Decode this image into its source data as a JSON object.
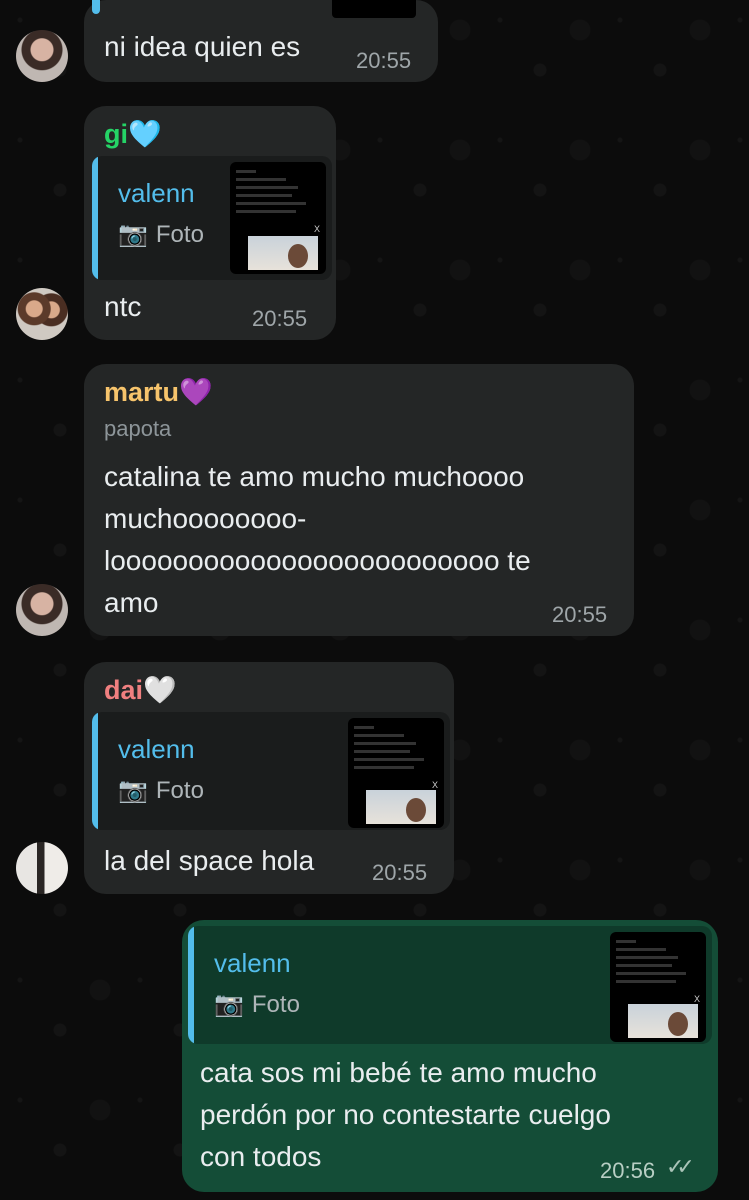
{
  "messages": [
    {
      "text": "ni idea quien es",
      "time": "20:55"
    },
    {
      "sender": "gi🩵",
      "quote": {
        "name": "valenn",
        "type": "Foto"
      },
      "text": "ntc",
      "time": "20:55"
    },
    {
      "sender": "martu💜",
      "subtitle": "papota",
      "text": "catalina te amo mucho muchoooo\nmuchoooooooo-\nlooooooooooooooooooooooooo te\namo",
      "time": "20:55"
    },
    {
      "sender": "dai🤍",
      "quote": {
        "name": "valenn",
        "type": "Foto"
      },
      "text": "la del space hola",
      "time": "20:55"
    },
    {
      "quote": {
        "name": "valenn",
        "type": "Foto"
      },
      "text": "cata sos mi bebé te amo mucho\nperdón por no contestarte cuelgo\ncon todos",
      "time": "20:56"
    }
  ],
  "colors": {
    "incoming_bubble": "#242626",
    "outgoing_bubble": "#144d37",
    "sender_gi": "#25d366",
    "sender_martu": "#f7c46c",
    "sender_dai": "#f08080",
    "quote_accent": "#53bdeb"
  },
  "icons": {
    "camera": "camera-icon",
    "read_receipt": "double-check-icon"
  }
}
